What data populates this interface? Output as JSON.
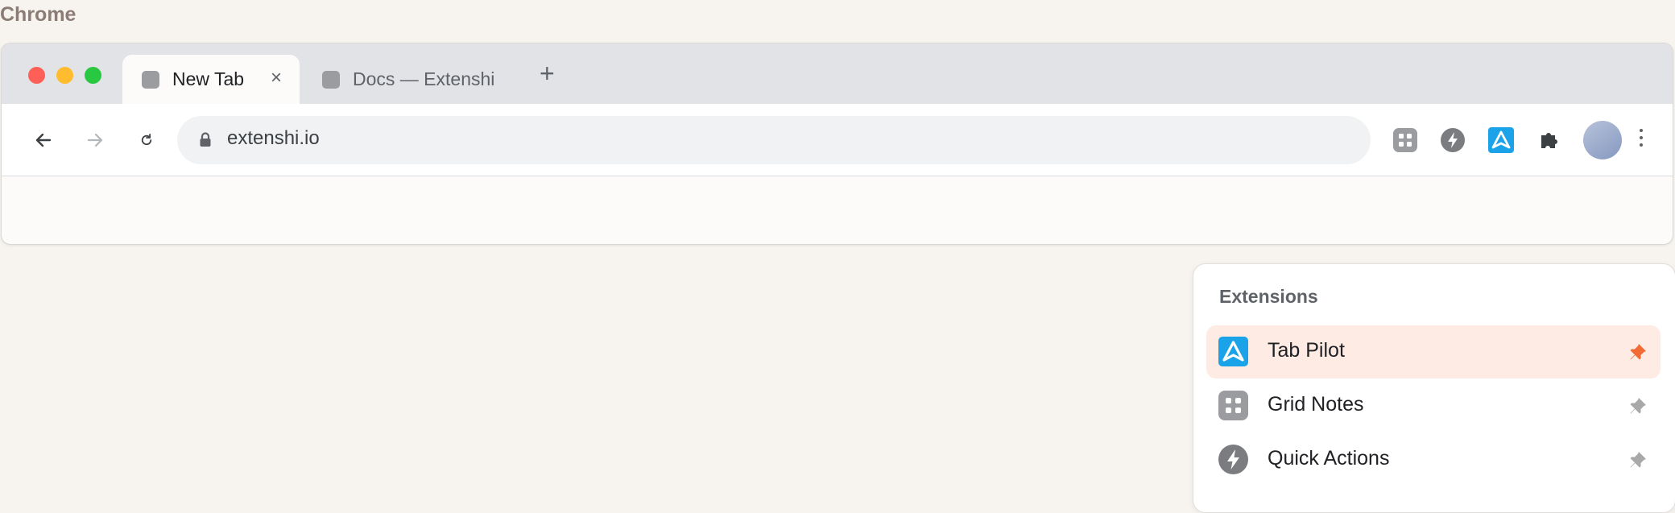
{
  "app_label": "Chrome",
  "tabs": [
    {
      "label": "New Tab",
      "active": true,
      "close": "×"
    },
    {
      "label": "Docs — Extenshi",
      "active": false
    }
  ],
  "new_tab_button": "+",
  "address_bar": {
    "url": "extenshi.io"
  },
  "toolbar_extensions": [
    "grid-notes-icon",
    "quick-actions-icon",
    "tab-pilot-icon",
    "extensions-puzzle-icon"
  ],
  "extensions_menu": {
    "title": "Extensions",
    "items": [
      {
        "label": "Tab Pilot",
        "icon": "tab-pilot-icon",
        "pinned": true,
        "highlighted": true
      },
      {
        "label": "Grid Notes",
        "icon": "grid-notes-icon",
        "pinned": false,
        "highlighted": false
      },
      {
        "label": "Quick Actions",
        "icon": "quick-actions-icon",
        "pinned": false,
        "highlighted": false
      }
    ]
  },
  "colors": {
    "accent_blue": "#1aa3e8",
    "pin_active": "#f26b35",
    "pin_inactive": "#a8a8a8",
    "highlight_row": "#fdebe4"
  }
}
